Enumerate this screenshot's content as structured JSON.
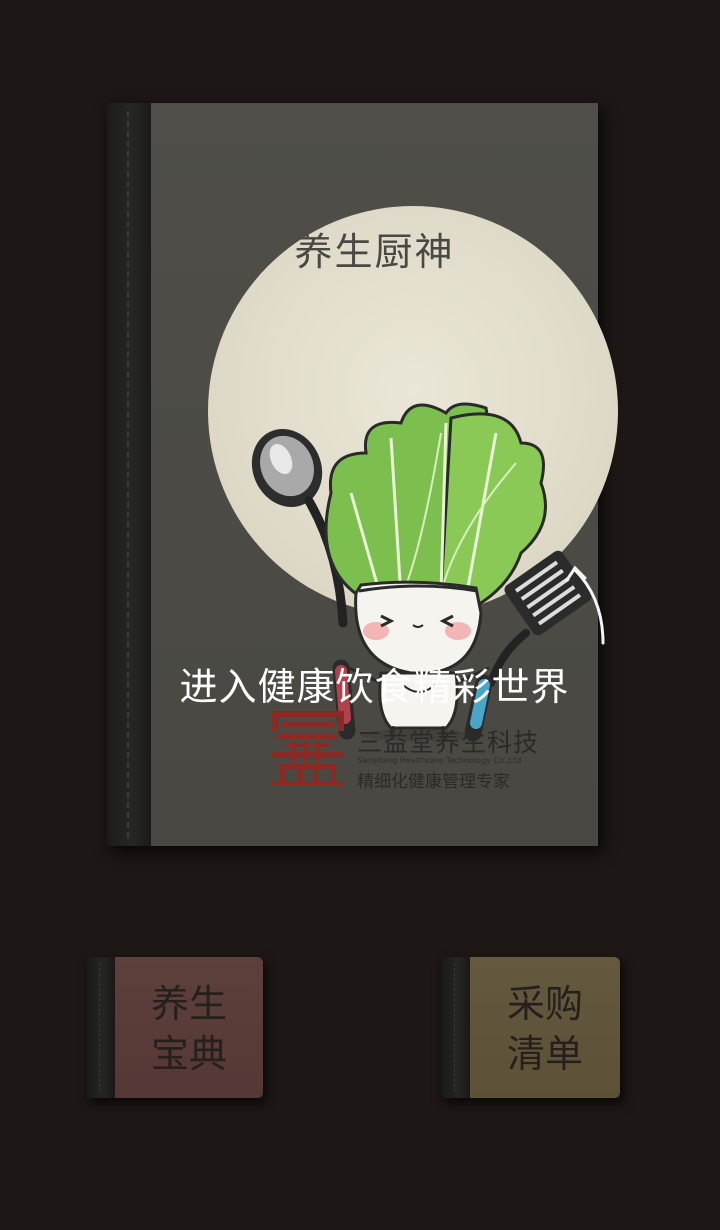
{
  "main_book": {
    "title": "养生厨神",
    "enter_text": "进入健康饮食精彩世界",
    "company_name": "三益堂养生科技",
    "company_name_en": "Sanyitang Healthcare Technology Co.,Ltd",
    "slogan": "精细化健康管理专家",
    "mascot_icon": "cabbage-chef-mascot-icon",
    "logo_icon": "sanyitang-logo-icon"
  },
  "mini_books": {
    "left_label": "养生\n宝典",
    "right_label": "采购\n清单"
  },
  "colors": {
    "background": "#1d1716",
    "cover": "#4b4a44",
    "disc": "#e2ddcb",
    "left_book": "#5d3f3c",
    "right_book": "#64593e",
    "logo_red": "#8a2a22"
  }
}
